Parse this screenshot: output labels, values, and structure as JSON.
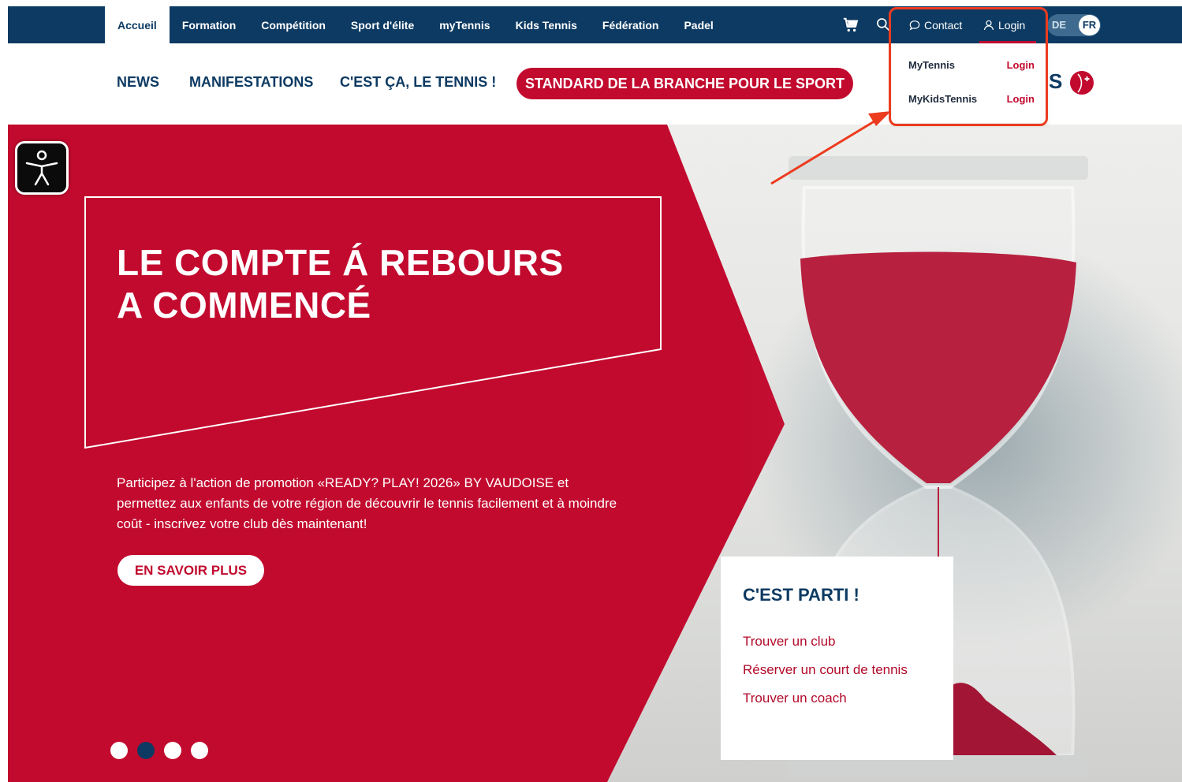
{
  "topnav": {
    "items": [
      "Accueil",
      "Formation",
      "Compétition",
      "Sport d'élite",
      "myTennis",
      "Kids Tennis",
      "Fédération",
      "Padel"
    ],
    "contact_label": "Contact",
    "login_label": "Login"
  },
  "language": {
    "de": "DE",
    "fr": "FR",
    "selected": "FR"
  },
  "subnav": {
    "items": [
      "NEWS",
      "MANIFESTATIONS",
      "C'EST ÇA, LE TENNIS !"
    ],
    "cta_label": "STANDARD DE LA BRANCHE POUR LE SPORT"
  },
  "logo": {
    "visible_text": "S"
  },
  "login_dropdown": {
    "rows": [
      {
        "label": "MyTennis",
        "action": "Login"
      },
      {
        "label": "MyKidsTennis",
        "action": "Login"
      }
    ]
  },
  "hero": {
    "headline_line1": "LE COMPTE Á REBOURS",
    "headline_line2": "A COMMENCÉ",
    "body": "Participez à l'action de promotion «READY? PLAY! 2026» BY VAUDOISE et permettez aux enfants de votre région de découvrir le tennis facilement et à moindre coût - inscrivez votre club dès maintenant!",
    "button_label": "EN SAVOIR PLUS",
    "slides_count": 4,
    "active_slide": 2
  },
  "quick_links": {
    "title": "C'EST PARTI !",
    "links": [
      "Trouver un club",
      "Réserver un court de tennis",
      "Trouver un coach"
    ]
  },
  "colors": {
    "navy": "#0d3a62",
    "brand_red": "#c20a2e",
    "annotation_orange": "#ec3b1f"
  },
  "icons": [
    "cart-icon",
    "search-icon",
    "chat-bubble-icon",
    "user-icon",
    "accessibility-icon"
  ]
}
